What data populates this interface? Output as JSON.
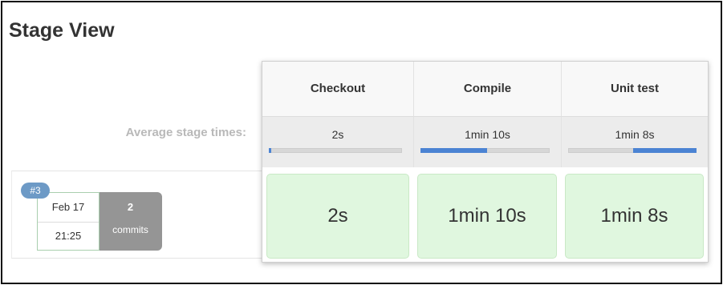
{
  "page": {
    "title": "Stage View"
  },
  "summary": {
    "avg_label": "Average stage times:"
  },
  "stages": [
    {
      "name": "Checkout",
      "avg": "2s",
      "avg_fraction": 0.02
    },
    {
      "name": "Compile",
      "avg": "1min 10s",
      "avg_fraction": 0.52
    },
    {
      "name": "Unit test",
      "avg": "1min 8s",
      "avg_fraction": 0.5,
      "fill_from_end": true
    }
  ],
  "build": {
    "number": "#3",
    "date": "Feb 17",
    "time": "21:25",
    "commits_count": "2",
    "commits_label": "commits",
    "durations": [
      "2s",
      "1min 10s",
      "1min 8s"
    ]
  },
  "colors": {
    "success_cell": "#e0f7df",
    "progress_fill": "#4b83d3",
    "badge": "#6d9ac6",
    "commits_box": "#959595"
  }
}
